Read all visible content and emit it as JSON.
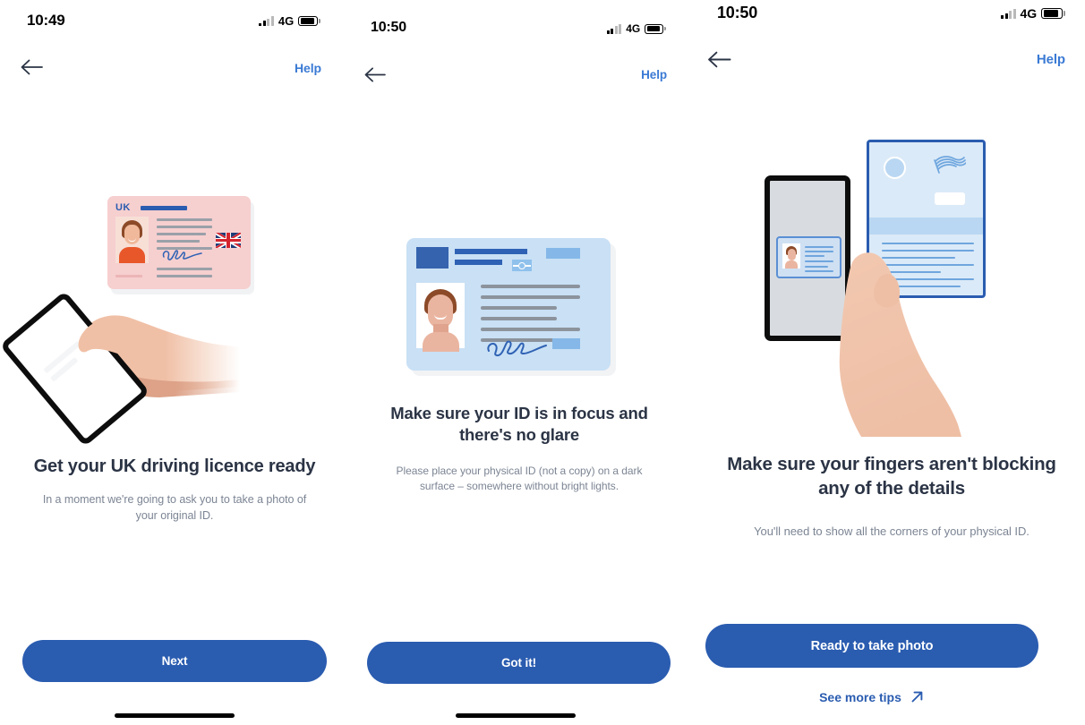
{
  "screens": [
    {
      "id": "screen-1",
      "status": {
        "time": "10:49",
        "network": "4G",
        "signal_icon": "cellular-bars-icon",
        "battery_icon": "battery-icon"
      },
      "nav": {
        "back_icon": "back-arrow-icon",
        "help_label": "Help"
      },
      "illustration": {
        "name": "hand-holding-phone-with-uk-licence-illustration",
        "card_label": "UK",
        "card_color": "#f6cfcf",
        "flag_icon": "union-jack-flag-icon",
        "signature_icon": "signature-icon"
      },
      "headline": "Get your UK driving licence ready",
      "subtext": "In a moment we're going to ask you to take a photo of your original ID.",
      "primary_button": "Next",
      "home_indicator": true
    },
    {
      "id": "screen-2",
      "status": {
        "time": "10:50",
        "network": "4G",
        "signal_icon": "cellular-bars-icon",
        "battery_icon": "battery-icon"
      },
      "nav": {
        "back_icon": "back-arrow-icon",
        "help_label": "Help"
      },
      "illustration": {
        "name": "blue-id-card-illustration",
        "card_color": "#c9e0f5",
        "chip_icon": "id-chip-icon",
        "signature_icon": "signature-icon"
      },
      "headline": "Make sure your ID is in focus and there's no glare",
      "subtext": "Please place your physical ID (not a copy) on a dark surface – somewhere without bright lights.",
      "primary_button": "Got it!",
      "home_indicator": true
    },
    {
      "id": "screen-3",
      "status": {
        "time": "10:50",
        "network": "4G",
        "signal_icon": "cellular-bars-icon",
        "battery_icon": "battery-icon"
      },
      "nav": {
        "back_icon": "back-arrow-icon",
        "help_label": "Help"
      },
      "illustration": {
        "name": "hand-holding-phone-scanning-document-illustration",
        "document_color": "#dbeaf8",
        "document_border_color": "#2a5cb0",
        "flag_icon": "waving-flag-icon"
      },
      "headline": "Make sure your fingers aren't blocking any of the details",
      "subtext": "You'll need to show all the corners of your physical ID.",
      "primary_button": "Ready to take photo",
      "secondary_link": {
        "label": "See more tips",
        "icon": "external-link-arrow-icon"
      },
      "home_indicator": false
    }
  ],
  "theme": {
    "brand_blue": "#2a5cb0",
    "link_blue": "#3a7ad4",
    "heading_color": "#2b3445",
    "body_color": "#7c8594",
    "background": "#ffffff"
  }
}
